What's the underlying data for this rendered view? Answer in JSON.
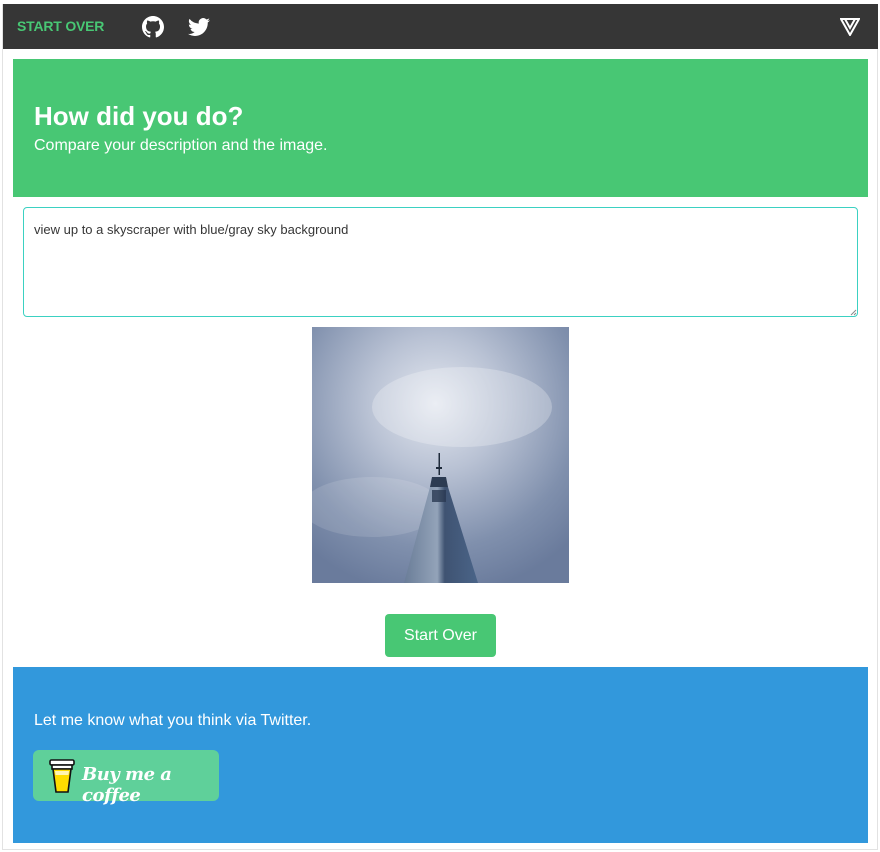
{
  "navbar": {
    "start_over_label": "START OVER",
    "icons": [
      "github-icon",
      "twitter-icon",
      "vuetify-logo-icon"
    ],
    "background": "#363636",
    "link_color": "#48c774"
  },
  "hero": {
    "title": "How did you do?",
    "subtitle": "Compare your description and the image.",
    "background": "#48c774"
  },
  "description": {
    "value": "view up to a skyscraper with blue/gray sky background"
  },
  "image": {
    "subject": "skyscraper-against-cloudy-sky"
  },
  "actions": {
    "start_over_button": "Start Over"
  },
  "footer": {
    "feedback_text": "Let me know what you think via Twitter.",
    "bmc_label": "Buy me a coffee",
    "background": "#3298dc"
  }
}
